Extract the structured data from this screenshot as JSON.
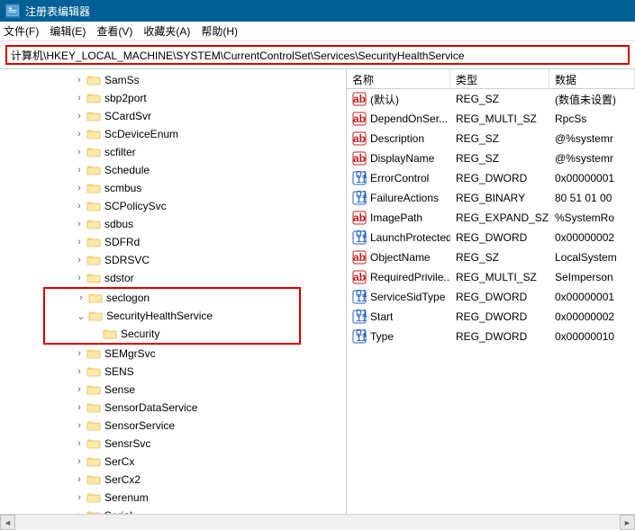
{
  "window": {
    "title": "注册表编辑器"
  },
  "menu": {
    "file": "文件(F)",
    "edit": "编辑(E)",
    "view": "查看(V)",
    "favorites": "收藏夹(A)",
    "help": "帮助(H)"
  },
  "addressbar": {
    "path": "计算机\\HKEY_LOCAL_MACHINE\\SYSTEM\\CurrentControlSet\\Services\\SecurityHealthService"
  },
  "tree": {
    "items": [
      {
        "label": "SamSs",
        "toggle": ">",
        "indent": 5
      },
      {
        "label": "sbp2port",
        "toggle": ">",
        "indent": 5
      },
      {
        "label": "SCardSvr",
        "toggle": ">",
        "indent": 5
      },
      {
        "label": "ScDeviceEnum",
        "toggle": ">",
        "indent": 5
      },
      {
        "label": "scfilter",
        "toggle": ">",
        "indent": 5
      },
      {
        "label": "Schedule",
        "toggle": ">",
        "indent": 5
      },
      {
        "label": "scmbus",
        "toggle": ">",
        "indent": 5
      },
      {
        "label": "SCPolicySvc",
        "toggle": ">",
        "indent": 5
      },
      {
        "label": "sdbus",
        "toggle": ">",
        "indent": 5
      },
      {
        "label": "SDFRd",
        "toggle": ">",
        "indent": 5
      },
      {
        "label": "SDRSVC",
        "toggle": ">",
        "indent": 5
      },
      {
        "label": "sdstor",
        "toggle": ">",
        "indent": 5
      }
    ],
    "highlighted": [
      {
        "label": "seclogon",
        "toggle": ">",
        "indent": 5
      },
      {
        "label": "SecurityHealthService",
        "toggle": "v",
        "indent": 5
      },
      {
        "label": "Security",
        "toggle": "",
        "indent": 6
      }
    ],
    "items_after": [
      {
        "label": "SEMgrSvc",
        "toggle": ">",
        "indent": 5
      },
      {
        "label": "SENS",
        "toggle": ">",
        "indent": 5
      },
      {
        "label": "Sense",
        "toggle": ">",
        "indent": 5
      },
      {
        "label": "SensorDataService",
        "toggle": ">",
        "indent": 5
      },
      {
        "label": "SensorService",
        "toggle": ">",
        "indent": 5
      },
      {
        "label": "SensrSvc",
        "toggle": ">",
        "indent": 5
      },
      {
        "label": "SerCx",
        "toggle": ">",
        "indent": 5
      },
      {
        "label": "SerCx2",
        "toggle": ">",
        "indent": 5
      },
      {
        "label": "Serenum",
        "toggle": ">",
        "indent": 5
      },
      {
        "label": "Serial",
        "toggle": ">",
        "indent": 5
      }
    ]
  },
  "list": {
    "headers": {
      "name": "名称",
      "type": "类型",
      "data": "数据"
    },
    "rows": [
      {
        "icon": "string",
        "name": "(默认)",
        "type": "REG_SZ",
        "data": "(数值未设置)"
      },
      {
        "icon": "string",
        "name": "DependOnSer...",
        "type": "REG_MULTI_SZ",
        "data": "RpcSs"
      },
      {
        "icon": "string",
        "name": "Description",
        "type": "REG_SZ",
        "data": "@%systemr"
      },
      {
        "icon": "string",
        "name": "DisplayName",
        "type": "REG_SZ",
        "data": "@%systemr"
      },
      {
        "icon": "binary",
        "name": "ErrorControl",
        "type": "REG_DWORD",
        "data": "0x00000001"
      },
      {
        "icon": "binary",
        "name": "FailureActions",
        "type": "REG_BINARY",
        "data": "80 51 01 00"
      },
      {
        "icon": "string",
        "name": "ImagePath",
        "type": "REG_EXPAND_SZ",
        "data": "%SystemRo"
      },
      {
        "icon": "binary",
        "name": "LaunchProtected",
        "type": "REG_DWORD",
        "data": "0x00000002"
      },
      {
        "icon": "string",
        "name": "ObjectName",
        "type": "REG_SZ",
        "data": "LocalSystem"
      },
      {
        "icon": "string",
        "name": "RequiredPrivile...",
        "type": "REG_MULTI_SZ",
        "data": "SeImperson"
      },
      {
        "icon": "binary",
        "name": "ServiceSidType",
        "type": "REG_DWORD",
        "data": "0x00000001"
      },
      {
        "icon": "binary",
        "name": "Start",
        "type": "REG_DWORD",
        "data": "0x00000002"
      },
      {
        "icon": "binary",
        "name": "Type",
        "type": "REG_DWORD",
        "data": "0x00000010"
      }
    ]
  }
}
